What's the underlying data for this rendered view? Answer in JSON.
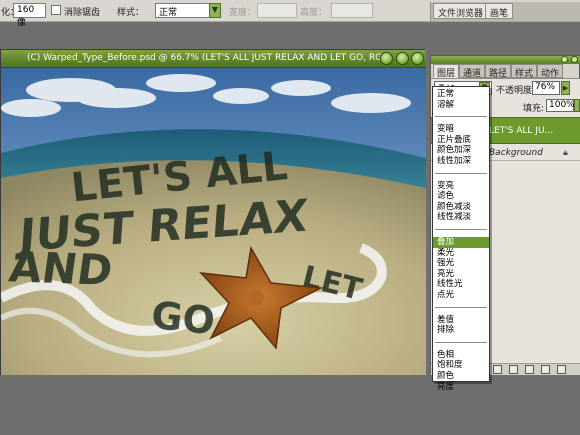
{
  "options_bar": {
    "size_label": "化：",
    "size_value": "160 像",
    "antialias_label": "消除锯齿",
    "style_label": "样式：",
    "style_value": "正常",
    "width_label": "宽度：",
    "height_label": "高度："
  },
  "palette_well": {
    "tabs": [
      "文件浏览器",
      "画笔"
    ]
  },
  "document": {
    "title": "(C) Warped_Type_Before.psd @ 66.7% (LET'S ALL JUST RELAX AND  LET GO, RGB)",
    "artwork_words": [
      "LET'S ALL",
      "JUST RELAX",
      "AND",
      "LET",
      "GO"
    ]
  },
  "layers_palette": {
    "tabs": [
      "图层",
      "通道",
      "路径",
      "样式",
      "动作"
    ],
    "blend_mode_value": "叠加",
    "opacity_label": "不透明度:",
    "opacity_value": "76%",
    "fill_label": "填充:",
    "fill_value": "100%",
    "layers": [
      {
        "name": "LET'S ALL JU...",
        "selected": true
      },
      {
        "name": "Background",
        "locked": true
      }
    ]
  },
  "blend_modes": {
    "selected": "叠加",
    "groups": [
      [
        "正常",
        "溶解"
      ],
      [
        "变暗",
        "正片叠底",
        "颜色加深",
        "线性加深"
      ],
      [
        "变亮",
        "滤色",
        "颜色减淡",
        "线性减淡"
      ],
      [
        "叠加",
        "柔光",
        "强光",
        "亮光",
        "线性光",
        "点光"
      ],
      [
        "差值",
        "排除"
      ],
      [
        "色相",
        "饱和度",
        "颜色",
        "亮度"
      ]
    ]
  },
  "colors": {
    "accent_green": "#6d9a2c",
    "title_green": "#5e8526",
    "workspace_gray": "#6f6f6f"
  }
}
